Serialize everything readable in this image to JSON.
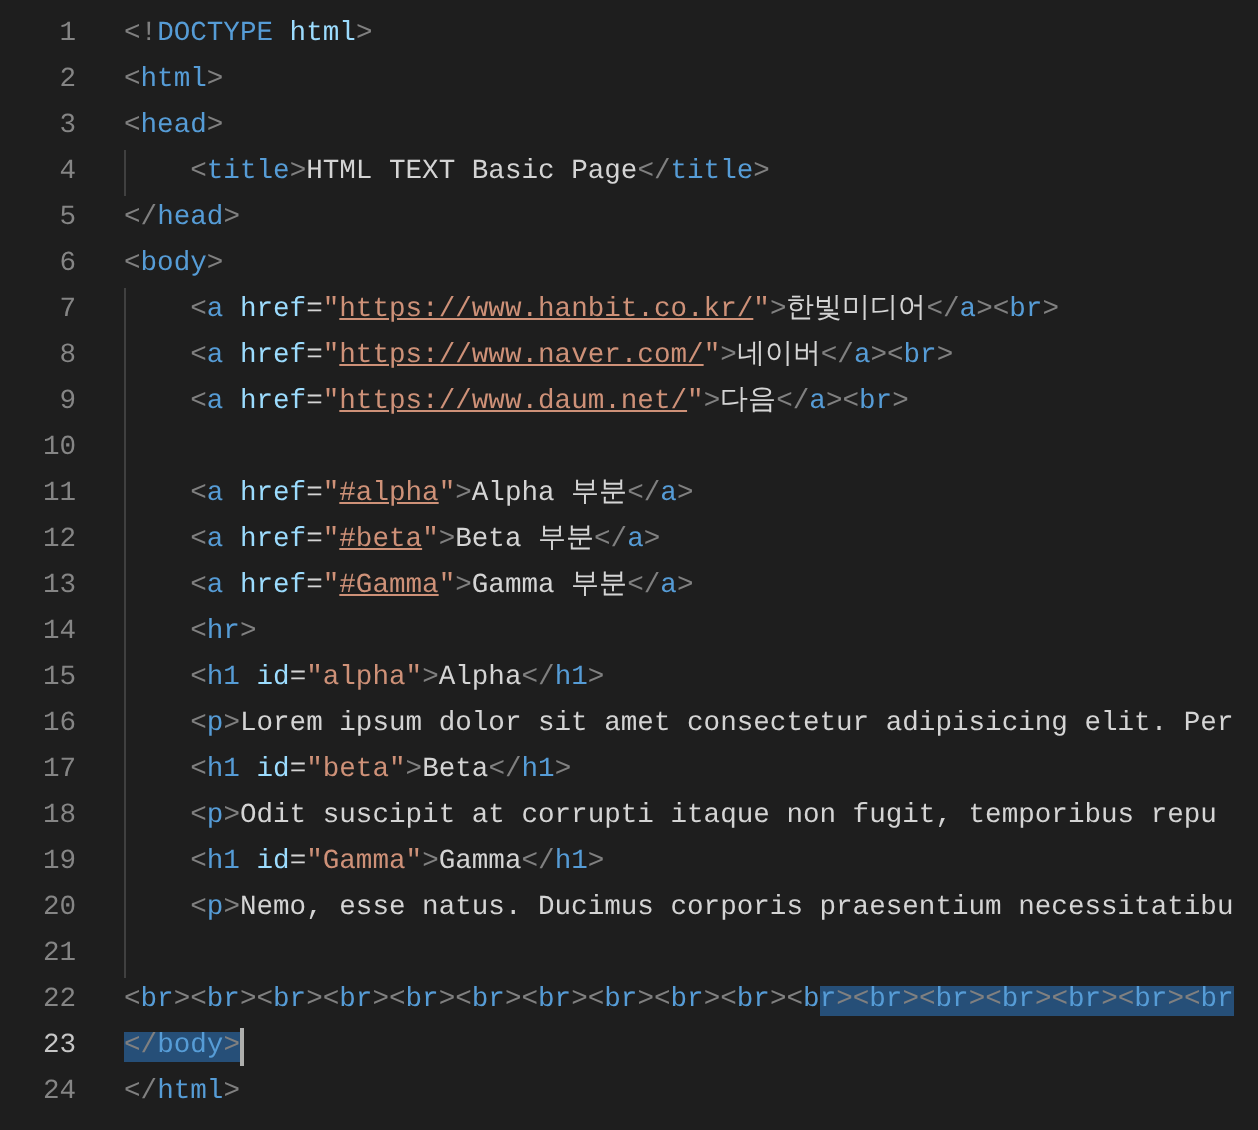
{
  "editor": {
    "lines": [
      {
        "number": "1",
        "current": false,
        "guide": false,
        "cursor": false,
        "tokens": [
          {
            "kind": "punct",
            "text": "<!"
          },
          {
            "kind": "tag",
            "text": "DOCTYPE"
          },
          {
            "kind": "attr",
            "text": " html"
          },
          {
            "kind": "punct",
            "text": ">"
          }
        ]
      },
      {
        "number": "2",
        "current": false,
        "guide": false,
        "cursor": false,
        "tokens": [
          {
            "kind": "punct",
            "text": "<"
          },
          {
            "kind": "tag",
            "text": "html"
          },
          {
            "kind": "punct",
            "text": ">"
          }
        ]
      },
      {
        "number": "3",
        "current": false,
        "guide": false,
        "cursor": false,
        "tokens": [
          {
            "kind": "punct",
            "text": "<"
          },
          {
            "kind": "tag",
            "text": "head"
          },
          {
            "kind": "punct",
            "text": ">"
          }
        ]
      },
      {
        "number": "4",
        "current": false,
        "guide": true,
        "cursor": false,
        "tokens": [
          {
            "kind": "punct",
            "text": "    <"
          },
          {
            "kind": "tag",
            "text": "title"
          },
          {
            "kind": "punct",
            "text": ">"
          },
          {
            "kind": "text",
            "text": "HTML TEXT Basic Page"
          },
          {
            "kind": "punct",
            "text": "</"
          },
          {
            "kind": "tag",
            "text": "title"
          },
          {
            "kind": "punct",
            "text": ">"
          }
        ]
      },
      {
        "number": "5",
        "current": false,
        "guide": false,
        "cursor": false,
        "tokens": [
          {
            "kind": "punct",
            "text": "</"
          },
          {
            "kind": "tag",
            "text": "head"
          },
          {
            "kind": "punct",
            "text": ">"
          }
        ]
      },
      {
        "number": "6",
        "current": false,
        "guide": false,
        "cursor": false,
        "tokens": [
          {
            "kind": "punct",
            "text": "<"
          },
          {
            "kind": "tag",
            "text": "body"
          },
          {
            "kind": "punct",
            "text": ">"
          }
        ]
      },
      {
        "number": "7",
        "current": false,
        "guide": true,
        "cursor": false,
        "tokens": [
          {
            "kind": "punct",
            "text": "    <"
          },
          {
            "kind": "tag",
            "text": "a"
          },
          {
            "kind": "attr",
            "text": " href"
          },
          {
            "kind": "text",
            "text": "="
          },
          {
            "kind": "string",
            "text": "\""
          },
          {
            "kind": "url",
            "text": "https://www.hanbit.co.kr/"
          },
          {
            "kind": "string",
            "text": "\""
          },
          {
            "kind": "punct",
            "text": ">"
          },
          {
            "kind": "text",
            "text": "한빛미디어"
          },
          {
            "kind": "punct",
            "text": "</"
          },
          {
            "kind": "tag",
            "text": "a"
          },
          {
            "kind": "punct",
            "text": "><"
          },
          {
            "kind": "tag",
            "text": "br"
          },
          {
            "kind": "punct",
            "text": ">"
          }
        ]
      },
      {
        "number": "8",
        "current": false,
        "guide": true,
        "cursor": false,
        "tokens": [
          {
            "kind": "punct",
            "text": "    <"
          },
          {
            "kind": "tag",
            "text": "a"
          },
          {
            "kind": "attr",
            "text": " href"
          },
          {
            "kind": "text",
            "text": "="
          },
          {
            "kind": "string",
            "text": "\""
          },
          {
            "kind": "url",
            "text": "https://www.naver.com/"
          },
          {
            "kind": "string",
            "text": "\""
          },
          {
            "kind": "punct",
            "text": ">"
          },
          {
            "kind": "text",
            "text": "네이버"
          },
          {
            "kind": "punct",
            "text": "</"
          },
          {
            "kind": "tag",
            "text": "a"
          },
          {
            "kind": "punct",
            "text": "><"
          },
          {
            "kind": "tag",
            "text": "br"
          },
          {
            "kind": "punct",
            "text": ">"
          }
        ]
      },
      {
        "number": "9",
        "current": false,
        "guide": true,
        "cursor": false,
        "tokens": [
          {
            "kind": "punct",
            "text": "    <"
          },
          {
            "kind": "tag",
            "text": "a"
          },
          {
            "kind": "attr",
            "text": " href"
          },
          {
            "kind": "text",
            "text": "="
          },
          {
            "kind": "string",
            "text": "\""
          },
          {
            "kind": "url",
            "text": "https://www.daum.net/"
          },
          {
            "kind": "string",
            "text": "\""
          },
          {
            "kind": "punct",
            "text": ">"
          },
          {
            "kind": "text",
            "text": "다음"
          },
          {
            "kind": "punct",
            "text": "</"
          },
          {
            "kind": "tag",
            "text": "a"
          },
          {
            "kind": "punct",
            "text": "><"
          },
          {
            "kind": "tag",
            "text": "br"
          },
          {
            "kind": "punct",
            "text": ">"
          }
        ]
      },
      {
        "number": "10",
        "current": false,
        "guide": true,
        "cursor": false
      },
      {
        "number": "11",
        "current": false,
        "guide": true,
        "cursor": false,
        "tokens": [
          {
            "kind": "punct",
            "text": "    <"
          },
          {
            "kind": "tag",
            "text": "a"
          },
          {
            "kind": "attr",
            "text": " href"
          },
          {
            "kind": "text",
            "text": "="
          },
          {
            "kind": "string",
            "text": "\""
          },
          {
            "kind": "url",
            "text": "#alpha"
          },
          {
            "kind": "string",
            "text": "\""
          },
          {
            "kind": "punct",
            "text": ">"
          },
          {
            "kind": "text",
            "text": "Alpha 부분"
          },
          {
            "kind": "punct",
            "text": "</"
          },
          {
            "kind": "tag",
            "text": "a"
          },
          {
            "kind": "punct",
            "text": ">"
          }
        ]
      },
      {
        "number": "12",
        "current": false,
        "guide": true,
        "cursor": false,
        "tokens": [
          {
            "kind": "punct",
            "text": "    <"
          },
          {
            "kind": "tag",
            "text": "a"
          },
          {
            "kind": "attr",
            "text": " href"
          },
          {
            "kind": "text",
            "text": "="
          },
          {
            "kind": "string",
            "text": "\""
          },
          {
            "kind": "url",
            "text": "#beta"
          },
          {
            "kind": "string",
            "text": "\""
          },
          {
            "kind": "punct",
            "text": ">"
          },
          {
            "kind": "text",
            "text": "Beta 부분"
          },
          {
            "kind": "punct",
            "text": "</"
          },
          {
            "kind": "tag",
            "text": "a"
          },
          {
            "kind": "punct",
            "text": ">"
          }
        ]
      },
      {
        "number": "13",
        "current": false,
        "guide": true,
        "cursor": false,
        "tokens": [
          {
            "kind": "punct",
            "text": "    <"
          },
          {
            "kind": "tag",
            "text": "a"
          },
          {
            "kind": "attr",
            "text": " href"
          },
          {
            "kind": "text",
            "text": "="
          },
          {
            "kind": "string",
            "text": "\""
          },
          {
            "kind": "url",
            "text": "#Gamma"
          },
          {
            "kind": "string",
            "text": "\""
          },
          {
            "kind": "punct",
            "text": ">"
          },
          {
            "kind": "text",
            "text": "Gamma 부분"
          },
          {
            "kind": "punct",
            "text": "</"
          },
          {
            "kind": "tag",
            "text": "a"
          },
          {
            "kind": "punct",
            "text": ">"
          }
        ]
      },
      {
        "number": "14",
        "current": false,
        "guide": true,
        "cursor": false,
        "tokens": [
          {
            "kind": "punct",
            "text": "    <"
          },
          {
            "kind": "tag",
            "text": "hr"
          },
          {
            "kind": "punct",
            "text": ">"
          }
        ]
      },
      {
        "number": "15",
        "current": false,
        "guide": true,
        "cursor": false,
        "tokens": [
          {
            "kind": "punct",
            "text": "    <"
          },
          {
            "kind": "tag",
            "text": "h1"
          },
          {
            "kind": "attr",
            "text": " id"
          },
          {
            "kind": "text",
            "text": "="
          },
          {
            "kind": "string",
            "text": "\"alpha\""
          },
          {
            "kind": "punct",
            "text": ">"
          },
          {
            "kind": "text",
            "text": "Alpha"
          },
          {
            "kind": "punct",
            "text": "</"
          },
          {
            "kind": "tag",
            "text": "h1"
          },
          {
            "kind": "punct",
            "text": ">"
          }
        ]
      },
      {
        "number": "16",
        "current": false,
        "guide": true,
        "cursor": false,
        "tokens": [
          {
            "kind": "punct",
            "text": "    <"
          },
          {
            "kind": "tag",
            "text": "p"
          },
          {
            "kind": "punct",
            "text": ">"
          },
          {
            "kind": "text",
            "text": "Lorem ipsum dolor sit amet consectetur adipisicing elit. Per"
          }
        ]
      },
      {
        "number": "17",
        "current": false,
        "guide": true,
        "cursor": false,
        "tokens": [
          {
            "kind": "punct",
            "text": "    <"
          },
          {
            "kind": "tag",
            "text": "h1"
          },
          {
            "kind": "attr",
            "text": " id"
          },
          {
            "kind": "text",
            "text": "="
          },
          {
            "kind": "string",
            "text": "\"beta\""
          },
          {
            "kind": "punct",
            "text": ">"
          },
          {
            "kind": "text",
            "text": "Beta"
          },
          {
            "kind": "punct",
            "text": "</"
          },
          {
            "kind": "tag",
            "text": "h1"
          },
          {
            "kind": "punct",
            "text": ">"
          }
        ]
      },
      {
        "number": "18",
        "current": false,
        "guide": true,
        "cursor": false,
        "tokens": [
          {
            "kind": "punct",
            "text": "    <"
          },
          {
            "kind": "tag",
            "text": "p"
          },
          {
            "kind": "punct",
            "text": ">"
          },
          {
            "kind": "text",
            "text": "Odit suscipit at corrupti itaque non fugit, temporibus repu"
          }
        ]
      },
      {
        "number": "19",
        "current": false,
        "guide": true,
        "cursor": false,
        "tokens": [
          {
            "kind": "punct",
            "text": "    <"
          },
          {
            "kind": "tag",
            "text": "h1"
          },
          {
            "kind": "attr",
            "text": " id"
          },
          {
            "kind": "text",
            "text": "="
          },
          {
            "kind": "string",
            "text": "\"Gamma\""
          },
          {
            "kind": "punct",
            "text": ">"
          },
          {
            "kind": "text",
            "text": "Gamma"
          },
          {
            "kind": "punct",
            "text": "</"
          },
          {
            "kind": "tag",
            "text": "h1"
          },
          {
            "kind": "punct",
            "text": ">"
          }
        ]
      },
      {
        "number": "20",
        "current": false,
        "guide": true,
        "cursor": false,
        "tokens": [
          {
            "kind": "punct",
            "text": "    <"
          },
          {
            "kind": "tag",
            "text": "p"
          },
          {
            "kind": "punct",
            "text": ">"
          },
          {
            "kind": "text",
            "text": "Nemo, esse natus. Ducimus corporis praesentium necessitatibu"
          }
        ]
      },
      {
        "number": "21",
        "current": false,
        "guide": true,
        "cursor": false
      },
      {
        "number": "22",
        "current": false,
        "guide": false,
        "cursor": false,
        "tokens": [
          {
            "kind": "punct",
            "text": "<"
          },
          {
            "kind": "tag",
            "text": "br"
          },
          {
            "kind": "punct",
            "text": "><"
          },
          {
            "kind": "tag",
            "text": "br"
          },
          {
            "kind": "punct",
            "text": "><"
          },
          {
            "kind": "tag",
            "text": "br"
          },
          {
            "kind": "punct",
            "text": "><"
          },
          {
            "kind": "tag",
            "text": "br"
          },
          {
            "kind": "punct",
            "text": "><"
          },
          {
            "kind": "tag",
            "text": "br"
          },
          {
            "kind": "punct",
            "text": "><"
          },
          {
            "kind": "tag",
            "text": "br"
          },
          {
            "kind": "punct",
            "text": "><"
          },
          {
            "kind": "tag",
            "text": "br"
          },
          {
            "kind": "punct",
            "text": "><"
          },
          {
            "kind": "tag",
            "text": "br"
          },
          {
            "kind": "punct",
            "text": "><"
          },
          {
            "kind": "tag",
            "text": "br"
          },
          {
            "kind": "punct",
            "text": "><"
          },
          {
            "kind": "tag",
            "text": "br"
          },
          {
            "kind": "punct",
            "text": "><"
          },
          {
            "kind": "tag",
            "text": "b"
          }
        ],
        "selection": [
          {
            "kind": "tag",
            "text": "r"
          },
          {
            "kind": "punct",
            "text": "><"
          },
          {
            "kind": "tag",
            "text": "br"
          },
          {
            "kind": "punct",
            "text": "><"
          },
          {
            "kind": "tag",
            "text": "br"
          },
          {
            "kind": "punct",
            "text": "><"
          },
          {
            "kind": "tag",
            "text": "br"
          },
          {
            "kind": "punct",
            "text": "><"
          },
          {
            "kind": "tag",
            "text": "br"
          },
          {
            "kind": "punct",
            "text": "><"
          },
          {
            "kind": "tag",
            "text": "br"
          },
          {
            "kind": "punct",
            "text": "><"
          },
          {
            "kind": "tag",
            "text": "br"
          }
        ]
      },
      {
        "number": "23",
        "current": true,
        "guide": false,
        "cursor": true,
        "selection": [
          {
            "kind": "punct",
            "text": "</"
          },
          {
            "kind": "tag",
            "text": "body"
          },
          {
            "kind": "punct",
            "text": ">"
          }
        ]
      },
      {
        "number": "24",
        "current": false,
        "guide": false,
        "cursor": false,
        "tokens": [
          {
            "kind": "punct",
            "text": "</"
          },
          {
            "kind": "tag",
            "text": "html"
          },
          {
            "kind": "punct",
            "text": ">"
          }
        ]
      }
    ]
  }
}
